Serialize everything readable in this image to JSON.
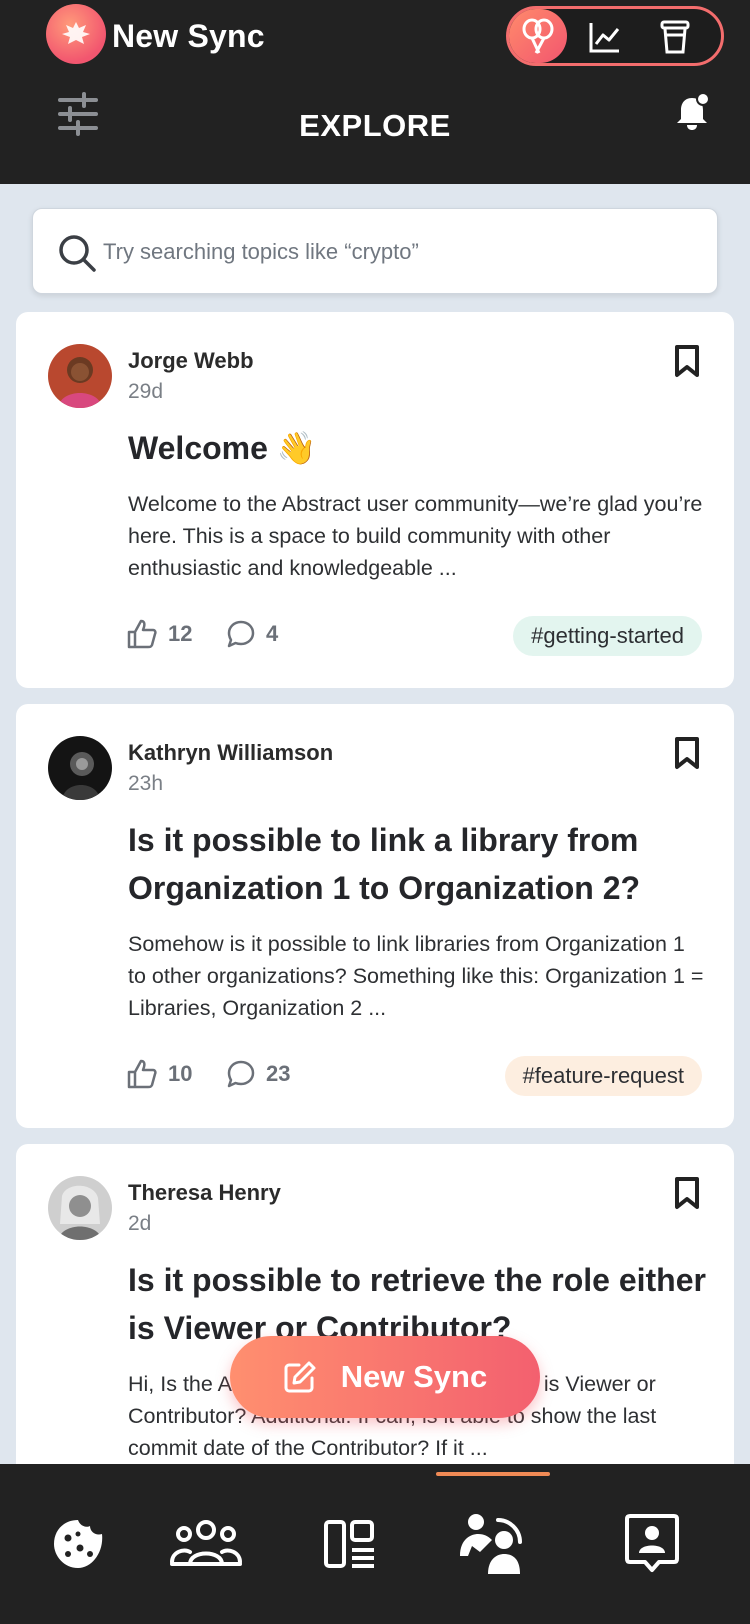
{
  "header": {
    "app_title": "New Sync",
    "page_title": "EXPLORE",
    "modes": [
      "balloons-icon",
      "chart-icon",
      "cup-icon"
    ]
  },
  "search": {
    "placeholder": "Try searching topics like “crypto”"
  },
  "posts": [
    {
      "author": "Jorge Webb",
      "age": "29d",
      "title": "Welcome 👋",
      "excerpt": "Welcome to the Abstract user community—we’re glad you’re here. This is a space to build community with other enthusiastic and knowledgeable ...",
      "likes": "12",
      "comments": "4",
      "tag": "#getting-started",
      "tag_color": "#e3f5ef"
    },
    {
      "author": "Kathryn Williamson",
      "age": "23h",
      "title": "Is it possible to link a library from Organization 1 to Organization 2?",
      "excerpt": "Somehow is it possible to link libraries from Organization 1 to other organizations? Something like this: Organization 1 = Libraries, Organization 2 ...",
      "likes": "10",
      "comments": "23",
      "tag": "#feature-request",
      "tag_color": "#fdeee0"
    },
    {
      "author": "Theresa Henry",
      "age": "2d",
      "title": "Is it possible to retrieve the role either is Viewer or Contributor?",
      "excerpt": "Hi, Is the API able to retrieve the role either is Viewer or Contributor? Additional: If can, is it able to show the last commit date of the Contributor? If it ..."
    }
  ],
  "fab": {
    "label": "New Sync"
  },
  "colors": {
    "accent": "#f2566f",
    "header_bg": "#222222",
    "page_bg": "#dfe6ee"
  }
}
